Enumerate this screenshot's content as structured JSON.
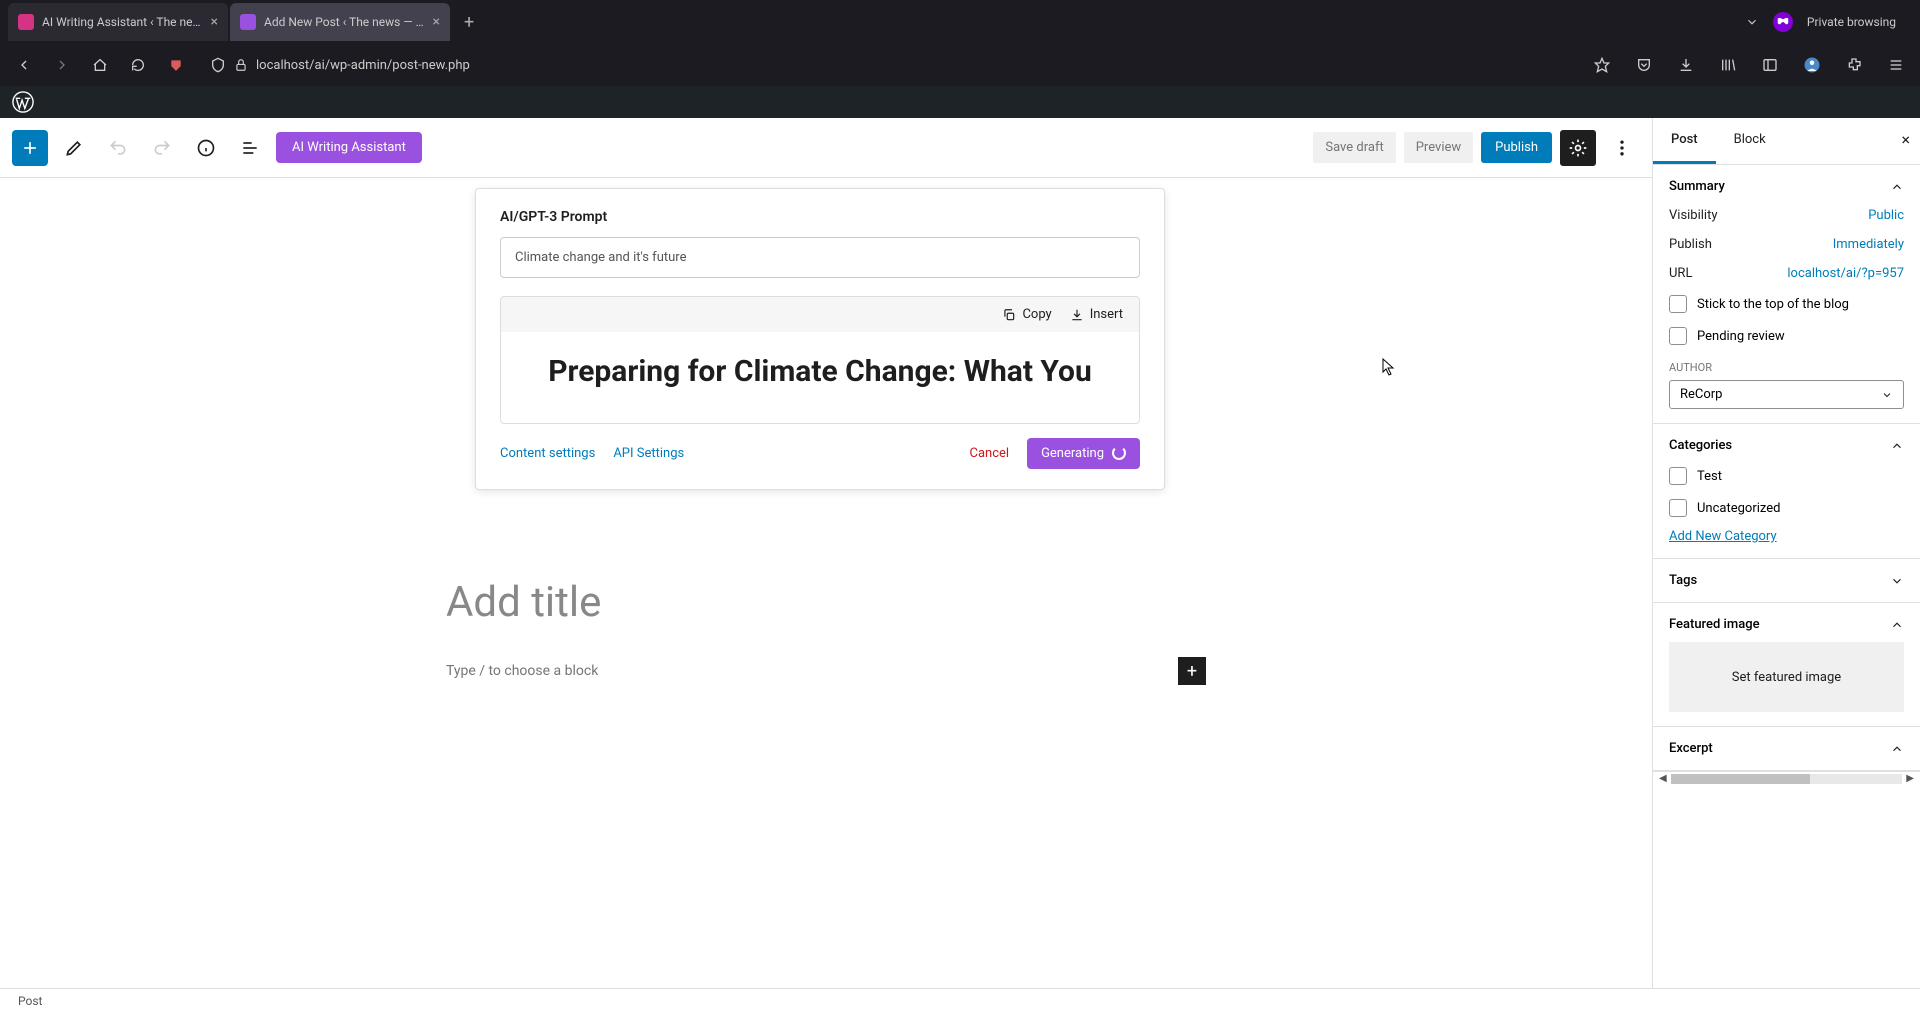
{
  "browser": {
    "tabs": [
      {
        "title": "AI Writing Assistant ‹ The news",
        "favicon_color": "#d63384"
      },
      {
        "title": "Add New Post ‹ The news — W…",
        "favicon_color": "#9b51e0"
      }
    ],
    "private_label": "Private browsing",
    "url": "localhost/ai/wp-admin/post-new.php"
  },
  "toolbar": {
    "ai_button": "AI Writing Assistant",
    "save_draft": "Save draft",
    "preview": "Preview",
    "publish": "Publish"
  },
  "ai_panel": {
    "title": "AI/GPT-3 Prompt",
    "prompt_value": "Climate change and it's future",
    "copy": "Copy",
    "insert": "Insert",
    "result_heading": "Preparing for Climate Change: What You",
    "content_settings": "Content settings",
    "api_settings": "API Settings",
    "cancel": "Cancel",
    "generating": "Generating"
  },
  "editor": {
    "title_placeholder": "Add title",
    "block_placeholder": "Type / to choose a block"
  },
  "sidebar": {
    "tabs": {
      "post": "Post",
      "block": "Block"
    },
    "summary": {
      "header": "Summary",
      "visibility_label": "Visibility",
      "visibility_value": "Public",
      "publish_label": "Publish",
      "publish_value": "Immediately",
      "url_label": "URL",
      "url_value": "localhost/ai/?p=957",
      "stick": "Stick to the top of the blog",
      "pending": "Pending review",
      "author_label": "AUTHOR",
      "author_value": "ReCorp"
    },
    "categories": {
      "header": "Categories",
      "items": [
        "Test",
        "Uncategorized"
      ],
      "add_new": "Add New Category"
    },
    "tags": {
      "header": "Tags"
    },
    "featured": {
      "header": "Featured image",
      "button": "Set featured image"
    },
    "excerpt": {
      "header": "Excerpt"
    }
  },
  "status_bar": "Post"
}
